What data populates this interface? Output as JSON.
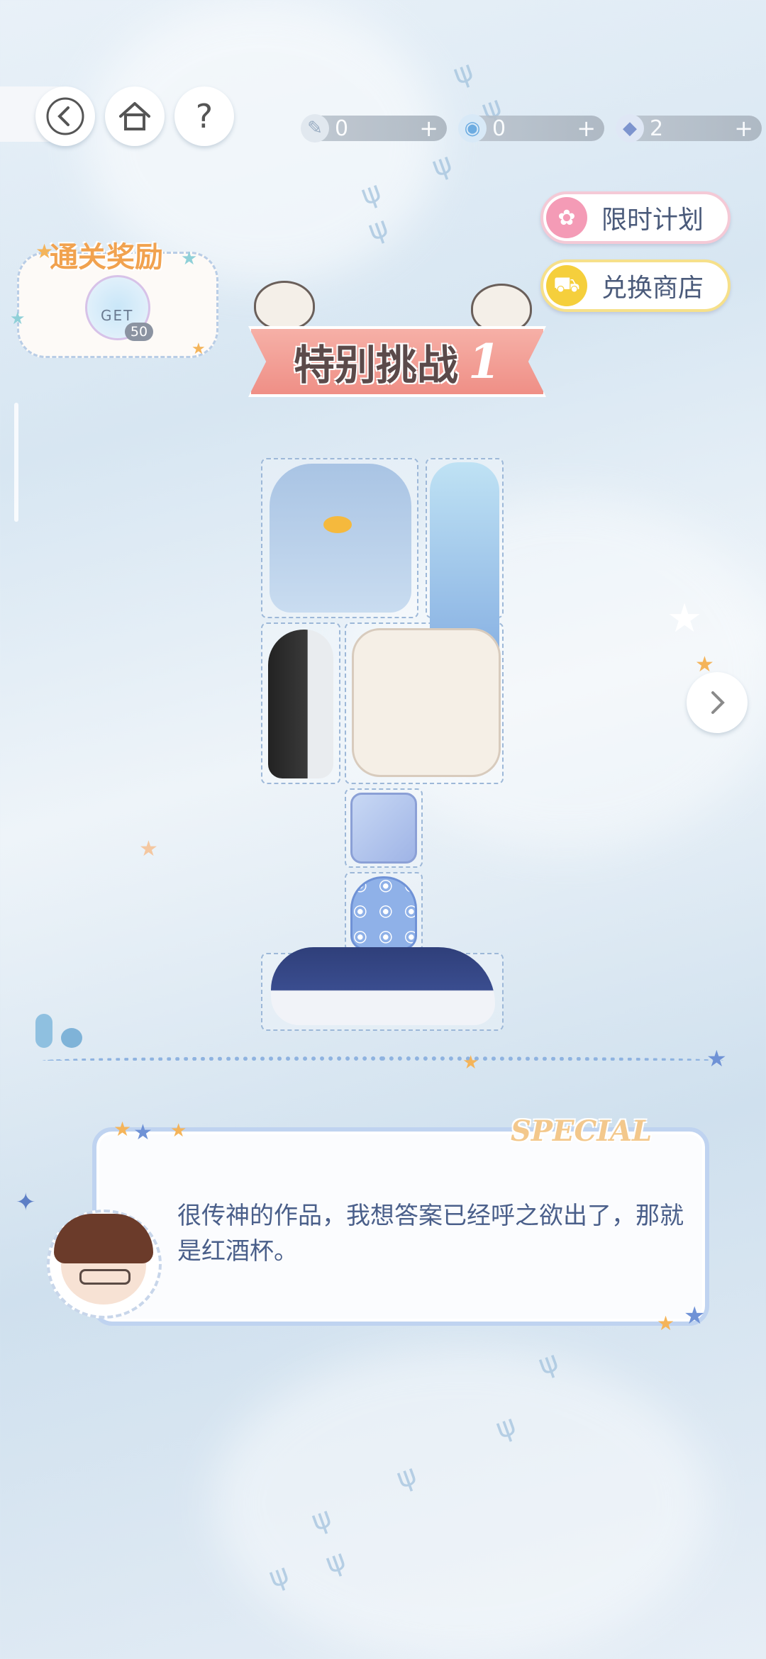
{
  "toolbar": {
    "back_icon": "back-arrow-icon",
    "home_icon": "home-icon",
    "help_label": "?"
  },
  "resources": [
    {
      "icon": "brush-icon",
      "value": "0",
      "plus": "+"
    },
    {
      "icon": "lollipop-icon",
      "value": "0",
      "plus": "+"
    },
    {
      "icon": "gem-icon",
      "value": "2",
      "plus": "+"
    }
  ],
  "side_buttons": {
    "limited_plan": "限时计划",
    "exchange_shop": "兑换商店"
  },
  "reward": {
    "title": "通关奖励",
    "get_label": "GET",
    "count": "50"
  },
  "level": {
    "title": "特别挑战",
    "number": "1"
  },
  "dialog": {
    "badge": "SPECIAL",
    "text": "很传神的作品，我想答案已经呼之欲出了，那就是红酒杯。"
  },
  "colors": {
    "accent_pink": "#ef8f86",
    "dialog_border": "#bfd3f0",
    "text_blue": "#4a5f8a"
  }
}
